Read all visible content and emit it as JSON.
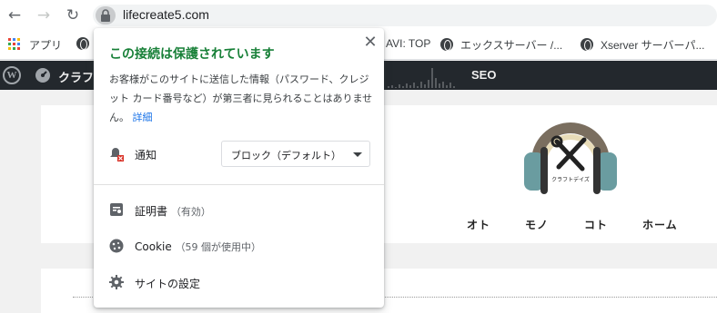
{
  "browser": {
    "url": "lifecreate5.com",
    "bookmarks": [
      {
        "label": "アプリ"
      },
      {
        "label": "AVI: TOP"
      },
      {
        "label": "エックスサーバー /..."
      },
      {
        "label": "Xserver サーバーパ..."
      }
    ]
  },
  "adminbar": {
    "site_label": "クラフ",
    "seo_label": "SEO"
  },
  "site": {
    "nav": [
      "オト",
      "モノ",
      "コト",
      "ホーム"
    ],
    "logo_text": "クラフトデイズ"
  },
  "popup": {
    "title": "この接続は保護されています",
    "description": "お客様がこのサイトに送信した情報（パスワード、クレジット カード番号など）が第三者に見られることはありません。",
    "details_link": "詳細",
    "notification_label": "通知",
    "notification_value": "ブロック（デフォルト）",
    "certificate_label": "証明書",
    "certificate_status": "（有効）",
    "cookie_label": "Cookie",
    "cookie_status": "（59 個が使用中）",
    "site_settings_label": "サイトの設定"
  },
  "colors": {
    "secure_green": "#188038",
    "link_blue": "#1a73e8",
    "adminbar_bg": "#23282d"
  }
}
